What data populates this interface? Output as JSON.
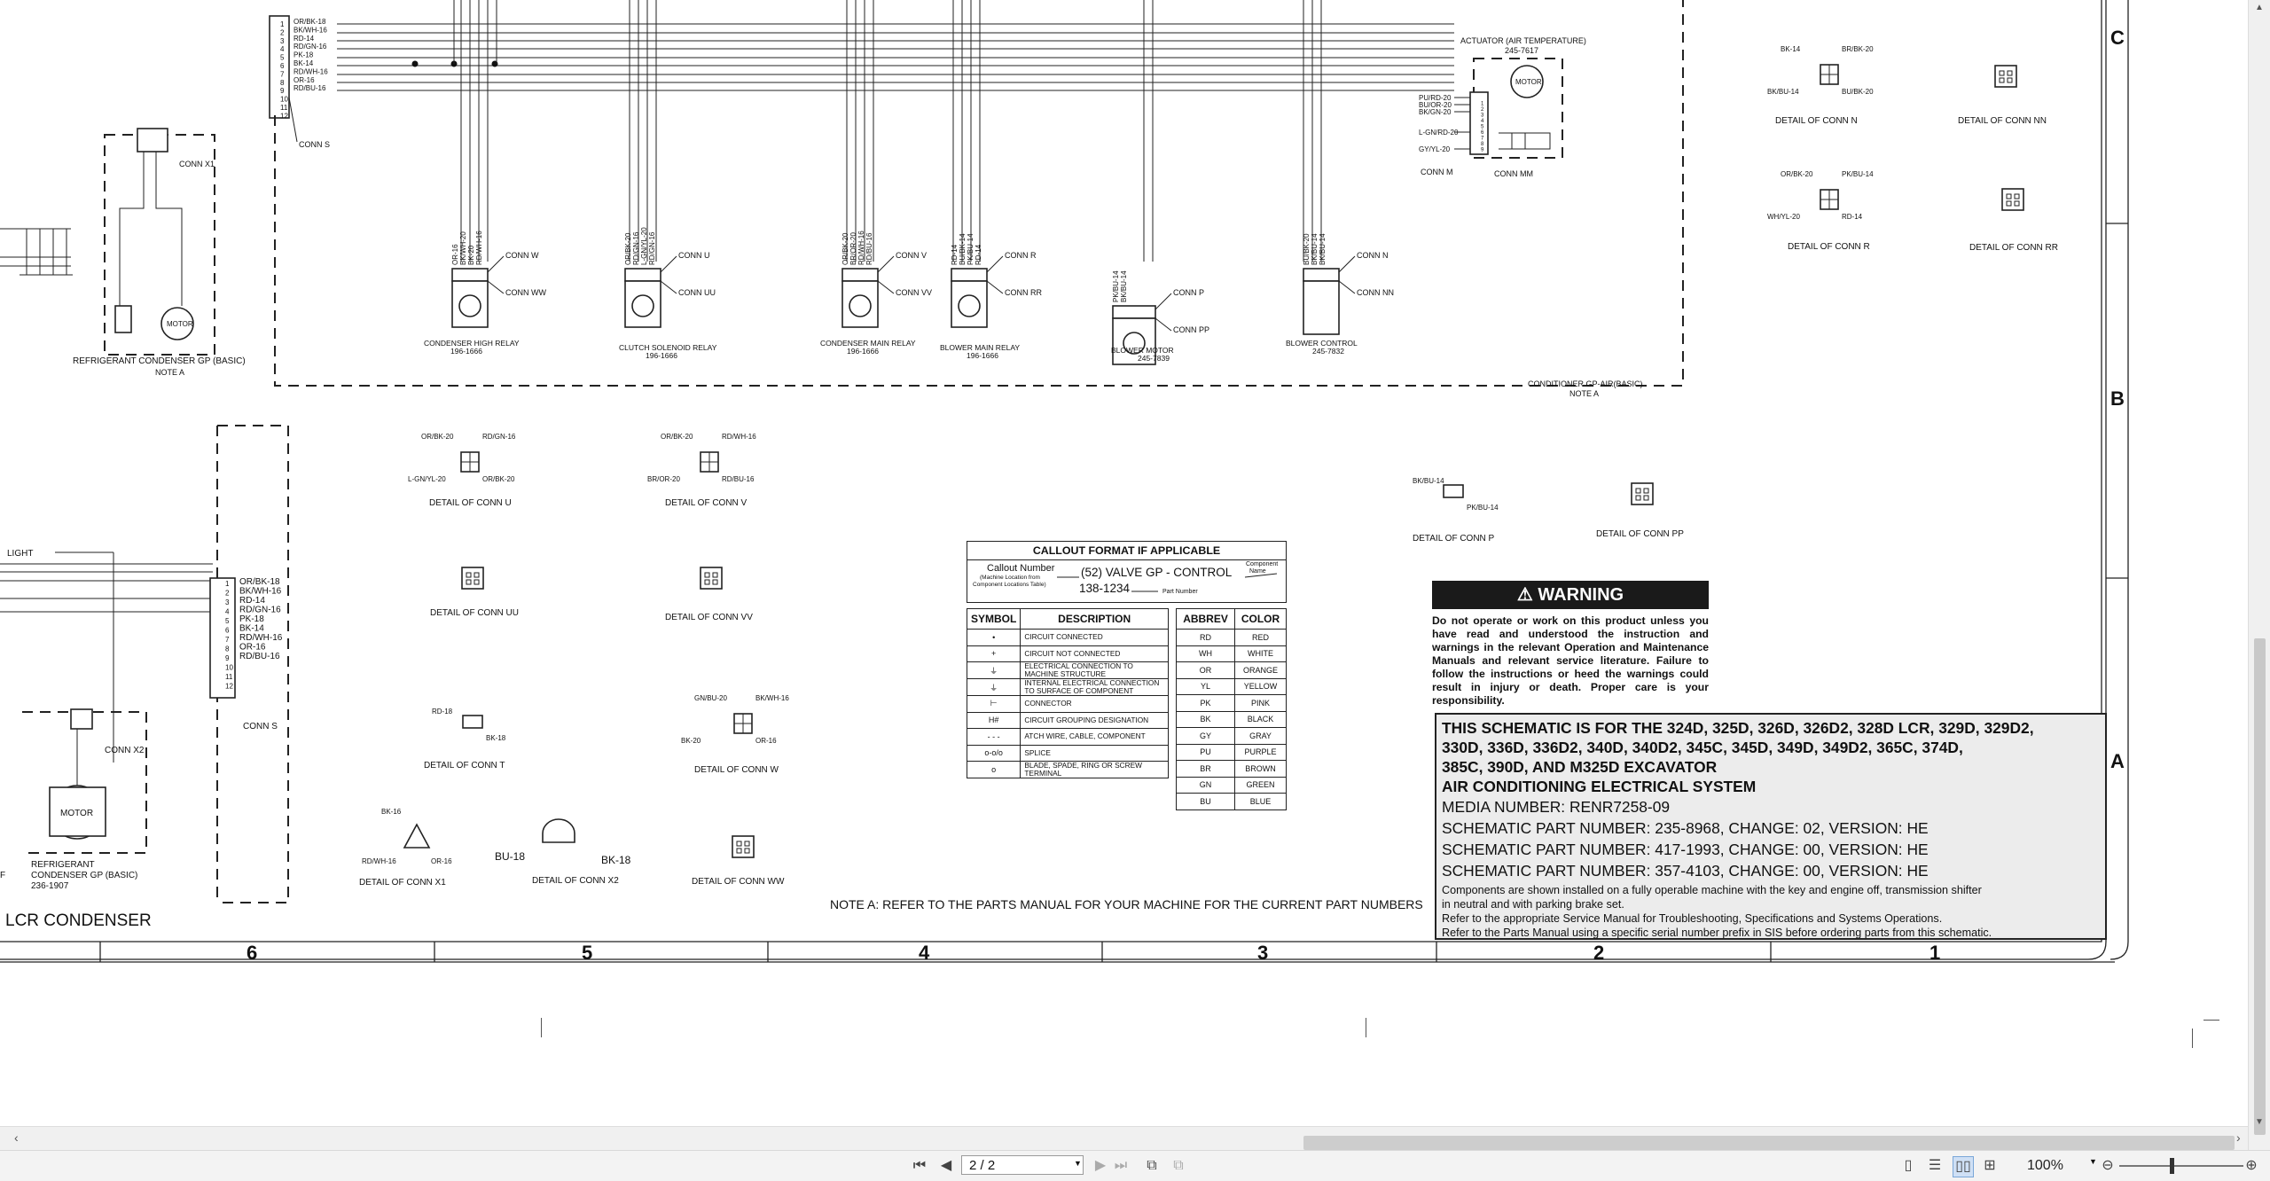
{
  "zones": {
    "c": "C",
    "b": "B",
    "a": "A"
  },
  "columns": [
    "6",
    "5",
    "4",
    "3",
    "2",
    "1"
  ],
  "left_panel": {
    "connector_s_top": {
      "pins": [
        "1",
        "2",
        "3",
        "4",
        "5",
        "6",
        "7",
        "8",
        "9",
        "10",
        "11",
        "12"
      ],
      "wires": [
        "OR/BK-18",
        "BK/WH-16",
        "RD-14",
        "RD/GN-16",
        "PK-18",
        "BK-14",
        "RD/WH-16",
        "OR-16",
        "RD/BU-16"
      ],
      "label": "CONN S"
    },
    "conn_x1_label": "CONN X1",
    "condenser_wires": [
      "BK-16",
      "RD/WH-16",
      "BK-16",
      "OR-16",
      "OR-16",
      "RD/WH-16"
    ],
    "motor_label": "MOTOR",
    "refrigerant_title": "REFRIGERANT CONDENSER GP (BASIC)",
    "refrigerant_note": "NOTE A",
    "light_label": "LIGHT",
    "connector_s_bottom": {
      "wires": [
        "OR/BK-18",
        "BK/WH-16",
        "RD-14",
        "RD/GN-16",
        "PK-18",
        "BK-14",
        "RD/WH-16",
        "OR-16",
        "RD/BU-16"
      ],
      "label": "CONN S"
    },
    "conn_x2_label": "CONN X2",
    "refrigerant_bottom_title": "REFRIGERANT",
    "refrigerant_bottom_title2": "CONDENSER GP (BASIC)",
    "refrigerant_bottom_part": "236-1907",
    "lcr_title": "LCR CONDENSER",
    "ref_prefix": "F"
  },
  "components": {
    "condenser_high_relay": {
      "title": "CONDENSER HIGH RELAY",
      "part": "196-1666",
      "wires": [
        "OR-16",
        "BK/WH-20",
        "BK-20",
        "RD/WH-16"
      ],
      "conn_a": "CONN W",
      "conn_b": "CONN WW"
    },
    "clutch_solenoid_relay": {
      "title": "CLUTCH SOLENOID RELAY",
      "part": "196-1666",
      "wires": [
        "OR/BK-20",
        "RD/GN-16",
        "L-GN/YL-20",
        "RD/GN-16"
      ],
      "conn_a": "CONN U",
      "conn_b": "CONN UU"
    },
    "condenser_main_relay": {
      "title": "CONDENSER MAIN RELAY",
      "part": "196-1666",
      "wires": [
        "OR/BK-20",
        "BR/OR-20",
        "RD/WH-16",
        "RD/BU-16"
      ],
      "conn_a": "CONN V",
      "conn_b": "CONN VV"
    },
    "blower_main_relay": {
      "title": "BLOWER MAIN RELAY",
      "part": "196-1666",
      "wires": [
        "RD-14",
        "BU/BK-14",
        "PK/BU-14",
        "RD-14"
      ],
      "conn_a": "CONN R",
      "conn_b": "CONN RR"
    },
    "blower_motor": {
      "title": "BLOWER MOTOR",
      "part": "245-7839",
      "wires": [
        "PK/BU-14",
        "BK/BU-14"
      ],
      "conn_a": "CONN P",
      "conn_b": "CONN PP"
    },
    "blower_control": {
      "title": "BLOWER CONTROL",
      "part": "245-7832",
      "wires": [
        "BU/BK-20",
        "BK/BU-14",
        "BK/BU-14"
      ],
      "conn_a": "CONN N",
      "conn_b": "CONN NN"
    },
    "actuator": {
      "title": "ACTUATOR (AIR TEMPERATURE)",
      "part": "245-7617",
      "wires": [
        "PU/RD-20",
        "BU/OR-20",
        "BK/GN-20",
        "L-GN/RD-20",
        "GY/YL-20"
      ],
      "conn_a": "CONN M",
      "conn_b": "CONN MM",
      "motor": "MOTOR"
    },
    "conditioner_title": "CONDITIONER GP-AIR(BASIC)",
    "conditioner_note": "NOTE A",
    "relay_pins": "1 2 3 4 5"
  },
  "details": {
    "conn_u": {
      "title": "DETAIL OF CONN U",
      "wires": [
        "OR/BK-20",
        "RD/GN-16",
        "L-GN/YL-20",
        "OR/BK-20"
      ]
    },
    "conn_v": {
      "title": "DETAIL OF CONN V",
      "wires": [
        "OR/BK-20",
        "RD/WH-16",
        "BR/OR-20",
        "RD/BU-16"
      ]
    },
    "conn_uu": {
      "title": "DETAIL OF CONN UU"
    },
    "conn_vv": {
      "title": "DETAIL OF CONN VV"
    },
    "conn_t": {
      "title": "DETAIL OF CONN T",
      "wires": [
        "RD-18",
        "BK-18"
      ]
    },
    "conn_w": {
      "title": "DETAIL OF CONN W",
      "wires": [
        "GN/BU-20",
        "BK/WH-16",
        "BK-20",
        "OR-16"
      ]
    },
    "conn_x1": {
      "title": "DETAIL OF CONN X1",
      "wires": [
        "BK-16",
        "RD/WH-16",
        "OR-16"
      ]
    },
    "conn_x2": {
      "title": "DETAIL OF CONN X2",
      "wires": [
        "BU-18",
        "BK-18"
      ]
    },
    "conn_ww": {
      "title": "DETAIL OF CONN WW"
    },
    "conn_n": {
      "title": "DETAIL OF CONN N",
      "wires": [
        "BK-14",
        "BR/BK-20",
        "BK/BU-14",
        "BU/BK-20"
      ]
    },
    "conn_nn": {
      "title": "DETAIL OF CONN NN"
    },
    "conn_r": {
      "title": "DETAIL OF CONN R",
      "wires": [
        "OR/BK-20",
        "PK/BU-14",
        "WH/YL-20",
        "RD-14"
      ]
    },
    "conn_rr": {
      "title": "DETAIL OF CONN RR"
    },
    "conn_p": {
      "title": "DETAIL OF CONN P",
      "wires": [
        "BK/BU-14",
        "PK/BU-14"
      ]
    },
    "conn_pp": {
      "title": "DETAIL OF CONN PP"
    }
  },
  "callout": {
    "title": "CALLOUT FORMAT IF APPLICABLE",
    "callout_number": "Callout Number",
    "machine_location": "(Machine Location from",
    "component_table": "Component Locations Table)",
    "example": "(52) VALVE GP - CONTROL",
    "part_example": "138-1234",
    "component_name": "Component",
    "component_name2": "Name",
    "part_number": "Part Number"
  },
  "symbol_table": {
    "headers": [
      "SYMBOL",
      "DESCRIPTION"
    ],
    "rows": [
      {
        "symbol": "•",
        "description": "CIRCUIT CONNECTED"
      },
      {
        "symbol": "+",
        "description": "CIRCUIT NOT CONNECTED"
      },
      {
        "symbol": "⏚",
        "description": "ELECTRICAL CONNECTION TO MACHINE STRUCTURE"
      },
      {
        "symbol": "⏚",
        "description": "INTERNAL ELECTRICAL CONNECTION TO SURFACE OF COMPONENT"
      },
      {
        "symbol": "⊢",
        "description": "CONNECTOR"
      },
      {
        "symbol": "H#",
        "description": "CIRCUIT GROUPING DESIGNATION"
      },
      {
        "symbol": "- - -",
        "description": "ATCH WIRE, CABLE, COMPONENT"
      },
      {
        "symbol": "o-o/o",
        "description": "SPLICE"
      },
      {
        "symbol": "o",
        "description": "BLADE, SPADE, RING OR SCREW TERMINAL"
      }
    ]
  },
  "color_table": {
    "headers": [
      "ABBREV",
      "COLOR"
    ],
    "rows": [
      [
        "RD",
        "RED"
      ],
      [
        "WH",
        "WHITE"
      ],
      [
        "OR",
        "ORANGE"
      ],
      [
        "YL",
        "YELLOW"
      ],
      [
        "PK",
        "PINK"
      ],
      [
        "BK",
        "BLACK"
      ],
      [
        "GY",
        "GRAY"
      ],
      [
        "PU",
        "PURPLE"
      ],
      [
        "BR",
        "BROWN"
      ],
      [
        "GN",
        "GREEN"
      ],
      [
        "BU",
        "BLUE"
      ]
    ]
  },
  "warning": {
    "title": "WARNING",
    "text": "Do not operate or work on this product unless you have read and understood the instruction and warnings in the relevant Operation and Maintenance Manuals and relevant service literature. Failure to follow the instructions or heed the warnings could result in injury or death. Proper care is your responsibility."
  },
  "title_block": {
    "line1": "THIS SCHEMATIC IS FOR THE 324D, 325D, 326D, 326D2, 328D LCR, 329D, 329D2,",
    "line2": "330D, 336D, 336D2, 340D, 340D2, 345C, 345D, 349D, 349D2, 365C, 374D,",
    "line3": "385C, 390D, AND M325D EXCAVATOR",
    "line4": "AIR CONDITIONING ELECTRICAL SYSTEM",
    "media": "MEDIA NUMBER: RENR7258-09",
    "part1": "SCHEMATIC PART NUMBER: 235-8968, CHANGE: 02, VERSION: HE",
    "part2": "SCHEMATIC PART NUMBER: 417-1993, CHANGE: 00, VERSION: HE",
    "part3": "SCHEMATIC PART NUMBER: 357-4103, CHANGE: 00, VERSION: HE",
    "note1": "Components are shown installed on a fully operable machine with the key and engine off, transmission shifter",
    "note2": "in neutral and with parking brake set.",
    "note3": "Refer to the appropriate Service Manual for Troubleshooting, Specifications and Systems Operations.",
    "note4": "Refer to the Parts Manual using a specific serial number prefix in SIS before ordering parts from this schematic."
  },
  "note_a": "NOTE A: REFER TO THE PARTS MANUAL FOR YOUR MACHINE FOR THE CURRENT PART NUMBERS",
  "viewer": {
    "page": "2 / 2",
    "zoom": "100%",
    "icons": [
      "first-page-icon",
      "prev-page-icon",
      "next-page-icon",
      "last-page-icon",
      "fit-page-icon",
      "fit-width-icon",
      "single-page-icon",
      "continuous-icon",
      "two-page-icon",
      "two-page-continuous-icon",
      "zoom-out-icon",
      "zoom-in-icon"
    ]
  }
}
